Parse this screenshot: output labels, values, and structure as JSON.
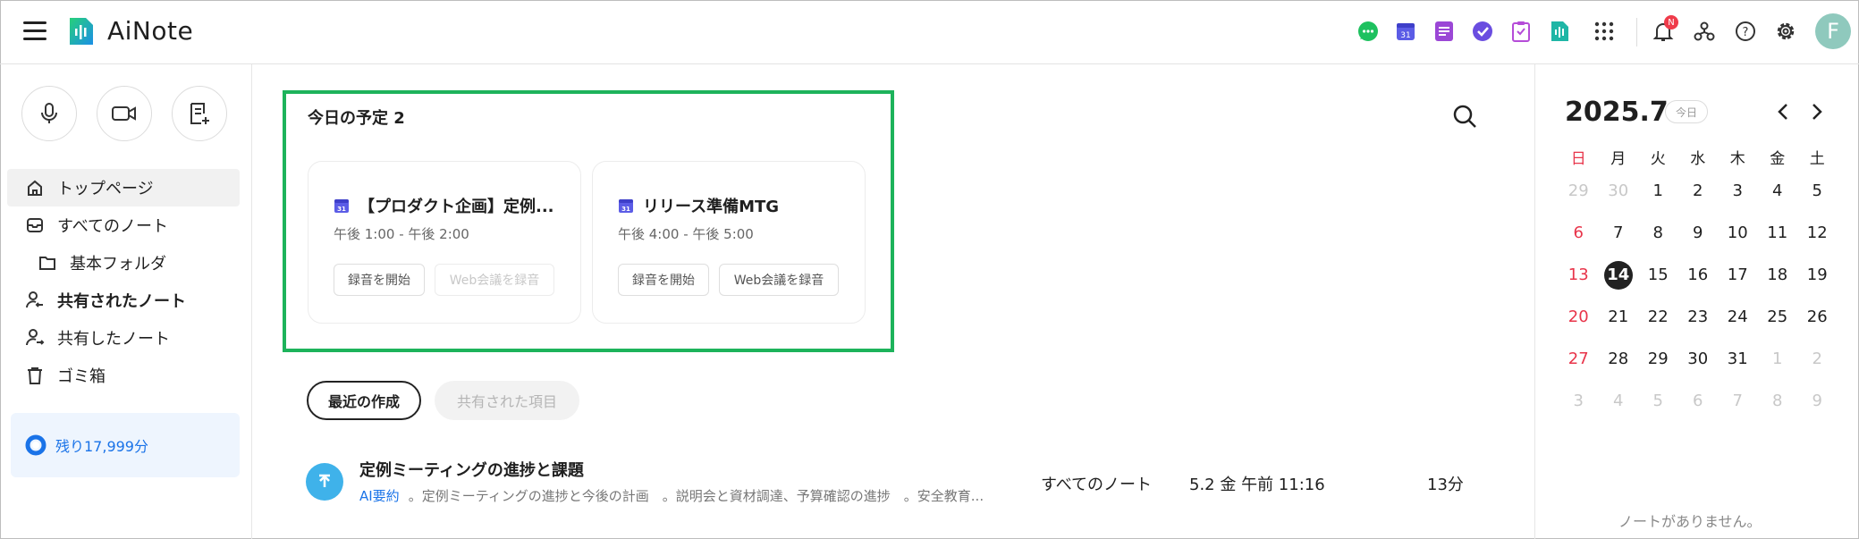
{
  "header": {
    "app_title": "AiNote",
    "notification_badge": "N",
    "avatar_letter": "F",
    "app_icons": [
      "chat-icon",
      "calendar-app-icon",
      "notes-app-icon",
      "tasks-app-icon",
      "forms-app-icon",
      "ainote-app-icon"
    ],
    "calendar_day": "31"
  },
  "sidebar": {
    "items": [
      {
        "label": "トップページ"
      },
      {
        "label": "すべてのノート"
      },
      {
        "label": "基本フォルダ"
      },
      {
        "label": "共有されたノート"
      },
      {
        "label": "共有したノート"
      },
      {
        "label": "ゴミ箱"
      }
    ],
    "quota": "残り17,999分"
  },
  "schedule": {
    "title": "今日の予定 2",
    "cards": [
      {
        "title": "【プロダクト企画】定例...",
        "time": "午後 1:00 - 午後 2:00",
        "record": "録音を開始",
        "web": "Web会議を録音",
        "web_disabled": true
      },
      {
        "title": "リリース準備MTG",
        "time": "午後 4:00 - 午後 5:00",
        "record": "録音を開始",
        "web": "Web会議を録音",
        "web_disabled": false
      }
    ]
  },
  "tabs": {
    "recent": "最近の作成",
    "shared": "共有された項目"
  },
  "notes": [
    {
      "title": "定例ミーティングの進捗と課題",
      "ai_label": "AI要約",
      "summary": "。定例ミーティングの進捗と今後の計画　。説明会と資材調達、予算確認の進捗　。安全教育...",
      "folder": "すべてのノート",
      "date": "5.2 金 午前 11:16",
      "duration": "13分"
    }
  ],
  "calendar": {
    "month": "2025.7",
    "today_label": "今日",
    "weekdays": [
      "日",
      "月",
      "火",
      "水",
      "木",
      "金",
      "土"
    ],
    "weeks": [
      [
        "29",
        "30",
        "1",
        "2",
        "3",
        "4",
        "5"
      ],
      [
        "6",
        "7",
        "8",
        "9",
        "10",
        "11",
        "12"
      ],
      [
        "13",
        "14",
        "15",
        "16",
        "17",
        "18",
        "19"
      ],
      [
        "20",
        "21",
        "22",
        "23",
        "24",
        "25",
        "26"
      ],
      [
        "27",
        "28",
        "29",
        "30",
        "31",
        "1",
        "2"
      ],
      [
        "3",
        "4",
        "5",
        "6",
        "7",
        "8",
        "9"
      ]
    ],
    "today": "14",
    "empty_message": "ノートがありません。"
  }
}
